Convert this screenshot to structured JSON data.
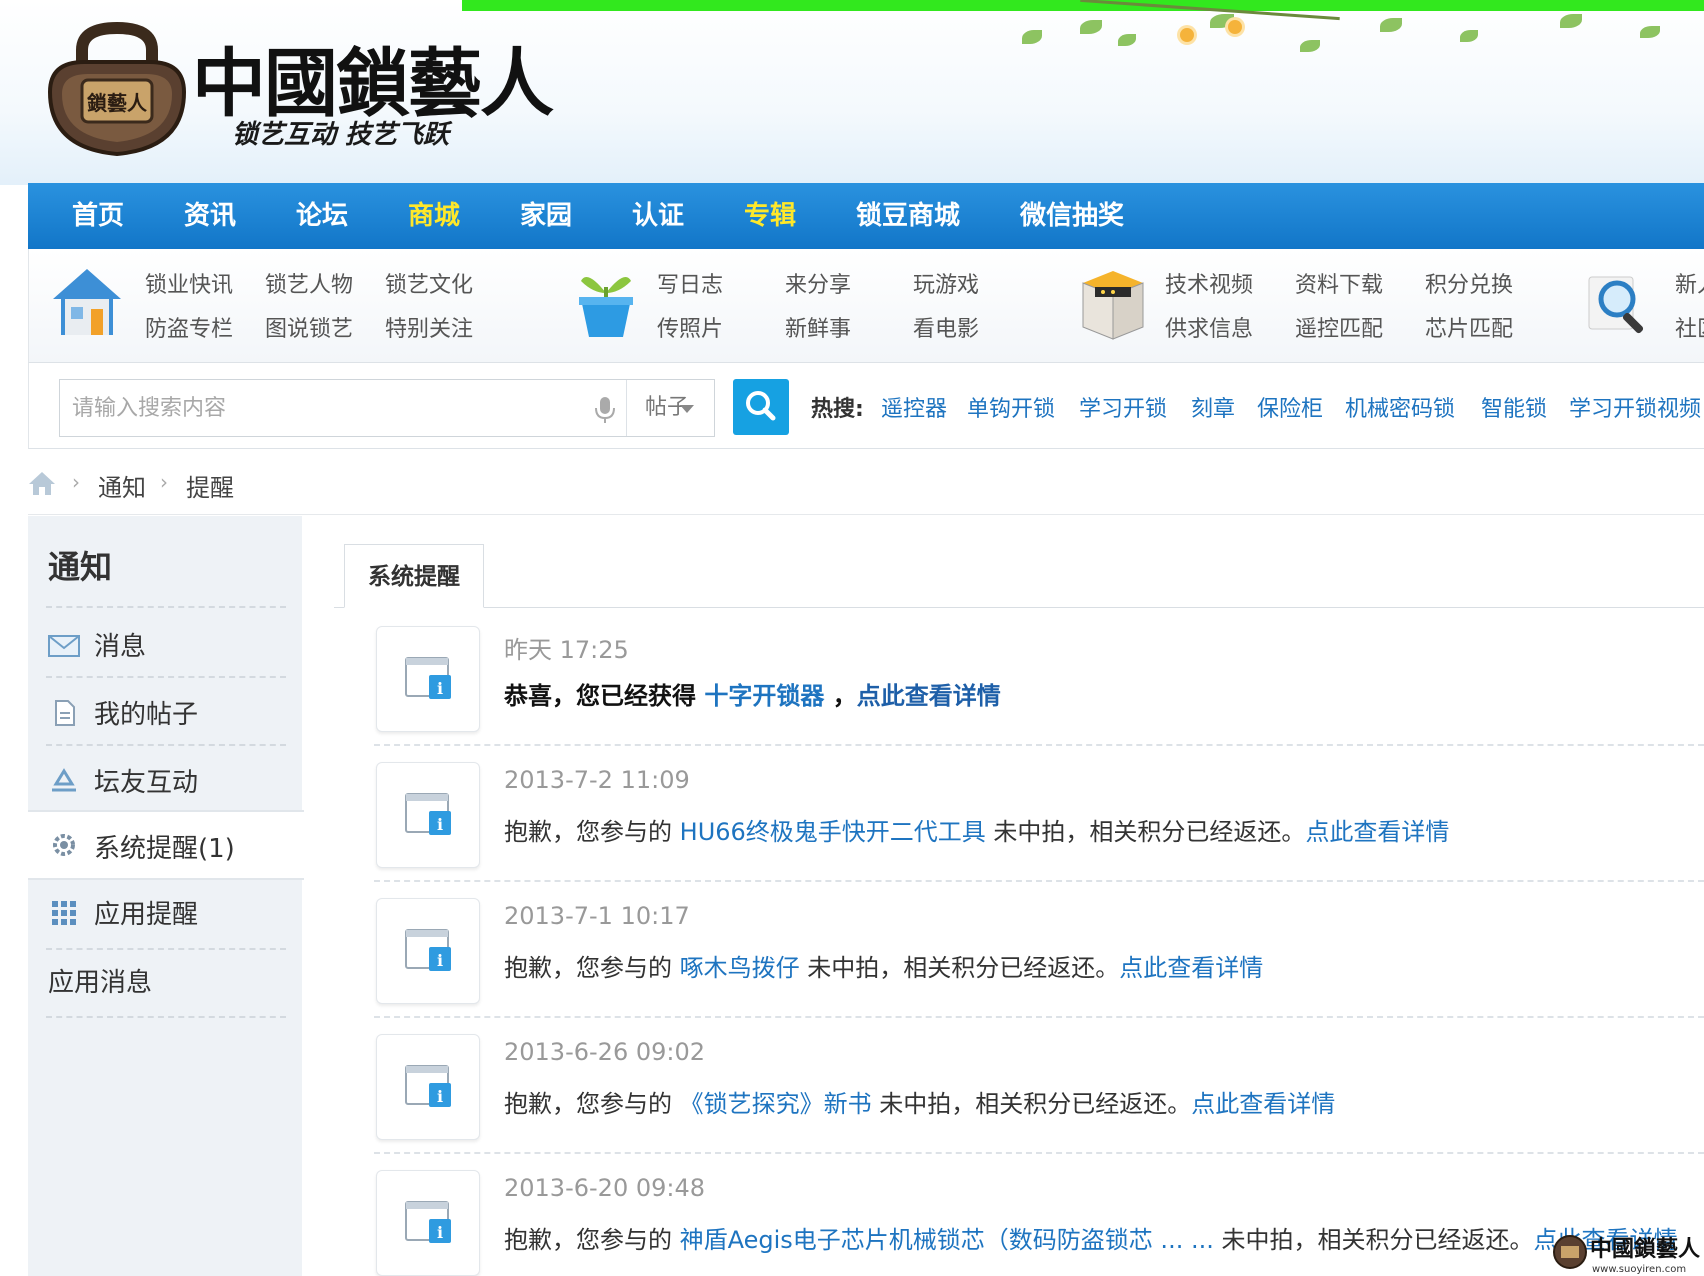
{
  "logo": {
    "title": "中國鎖藝人",
    "slogan": "锁艺互动 技艺飞跃",
    "badge": "鎖藝人"
  },
  "main_nav": [
    {
      "label": "首页",
      "highlight": false
    },
    {
      "label": "资讯",
      "highlight": false
    },
    {
      "label": "论坛",
      "highlight": false
    },
    {
      "label": "商城",
      "highlight": true
    },
    {
      "label": "家园",
      "highlight": false
    },
    {
      "label": "认证",
      "highlight": false
    },
    {
      "label": "专辑",
      "highlight": true
    },
    {
      "label": "锁豆商城",
      "highlight": false
    },
    {
      "label": "微信抽奖",
      "highlight": false
    }
  ],
  "sub_nav": {
    "group1": {
      "icon": "house-icon",
      "links": [
        "锁业快讯",
        "锁艺人物",
        "锁艺文化",
        "防盗专栏",
        "图说锁艺",
        "特别关注"
      ]
    },
    "group2": {
      "icon": "plant-pot-icon",
      "links": [
        "写日志",
        "来分享",
        "玩游戏",
        "传照片",
        "新鲜事",
        "看电影"
      ]
    },
    "group3": {
      "icon": "box-icon",
      "links": [
        "技术视频",
        "资料下载",
        "积分兑换",
        "供求信息",
        "遥控匹配",
        "芯片匹配"
      ]
    },
    "group4": {
      "icon": "magnifier-icon",
      "links": [
        "新人",
        "社区"
      ]
    }
  },
  "search": {
    "placeholder": "请输入搜索内容",
    "type": "帖子",
    "hot_label": "热搜:",
    "hot_terms": [
      "遥控器",
      "单钩开锁",
      "学习开锁",
      "刻章",
      "保险柜",
      "机械密码锁",
      "智能锁",
      "学习开锁视频"
    ]
  },
  "breadcrumb": [
    "通知",
    "提醒"
  ],
  "sidebar": {
    "title": "通知",
    "items": [
      {
        "label": "消息",
        "icon": "envelope-icon"
      },
      {
        "label": "我的帖子",
        "icon": "document-icon"
      },
      {
        "label": "坛友互动",
        "icon": "recycle-icon"
      },
      {
        "label": "系统提醒(1)",
        "icon": "gear-icon",
        "active": true
      },
      {
        "label": "应用提醒",
        "icon": "grid-icon"
      },
      {
        "label": "应用消息",
        "icon": ""
      }
    ]
  },
  "tab": {
    "label": "系统提醒"
  },
  "notices": [
    {
      "time": "昨天 17:25",
      "prefix": "恭喜，您已经获得 ",
      "item": "十字开锁器",
      "middle": " ，",
      "link": "点此查看详情",
      "bold": true
    },
    {
      "time": "2013-7-2 11:09",
      "prefix": "抱歉，您参与的 ",
      "item": "HU66终极鬼手快开二代工具",
      "middle": " 未中拍，相关积分已经返还。",
      "link": "点此查看详情",
      "bold": false
    },
    {
      "time": "2013-7-1 10:17",
      "prefix": "抱歉，您参与的 ",
      "item": "啄木鸟拨仔",
      "middle": " 未中拍，相关积分已经返还。",
      "link": "点此查看详情",
      "bold": false
    },
    {
      "time": "2013-6-26 09:02",
      "prefix": "抱歉，您参与的 ",
      "item": "《锁艺探究》新书",
      "middle": " 未中拍，相关积分已经返还。",
      "link": "点此查看详情",
      "bold": false
    },
    {
      "time": "2013-6-20 09:48",
      "prefix": "抱歉，您参与的 ",
      "item": "神盾Aegis电子芯片机械锁芯（数码防盗锁芯 ... ...",
      "middle": " 未中拍，相关积分已经返还。",
      "link": "点此查看详情",
      "bold": false
    }
  ],
  "watermark": {
    "text": "中國鎖藝人",
    "url": "www.suoyiren.com"
  },
  "colors": {
    "nav_blue": "#1a82d4",
    "nav_highlight": "#ffe82a",
    "link_blue": "#1e74c0",
    "search_button": "#16a1e2",
    "top_strip": "#32e81e"
  }
}
